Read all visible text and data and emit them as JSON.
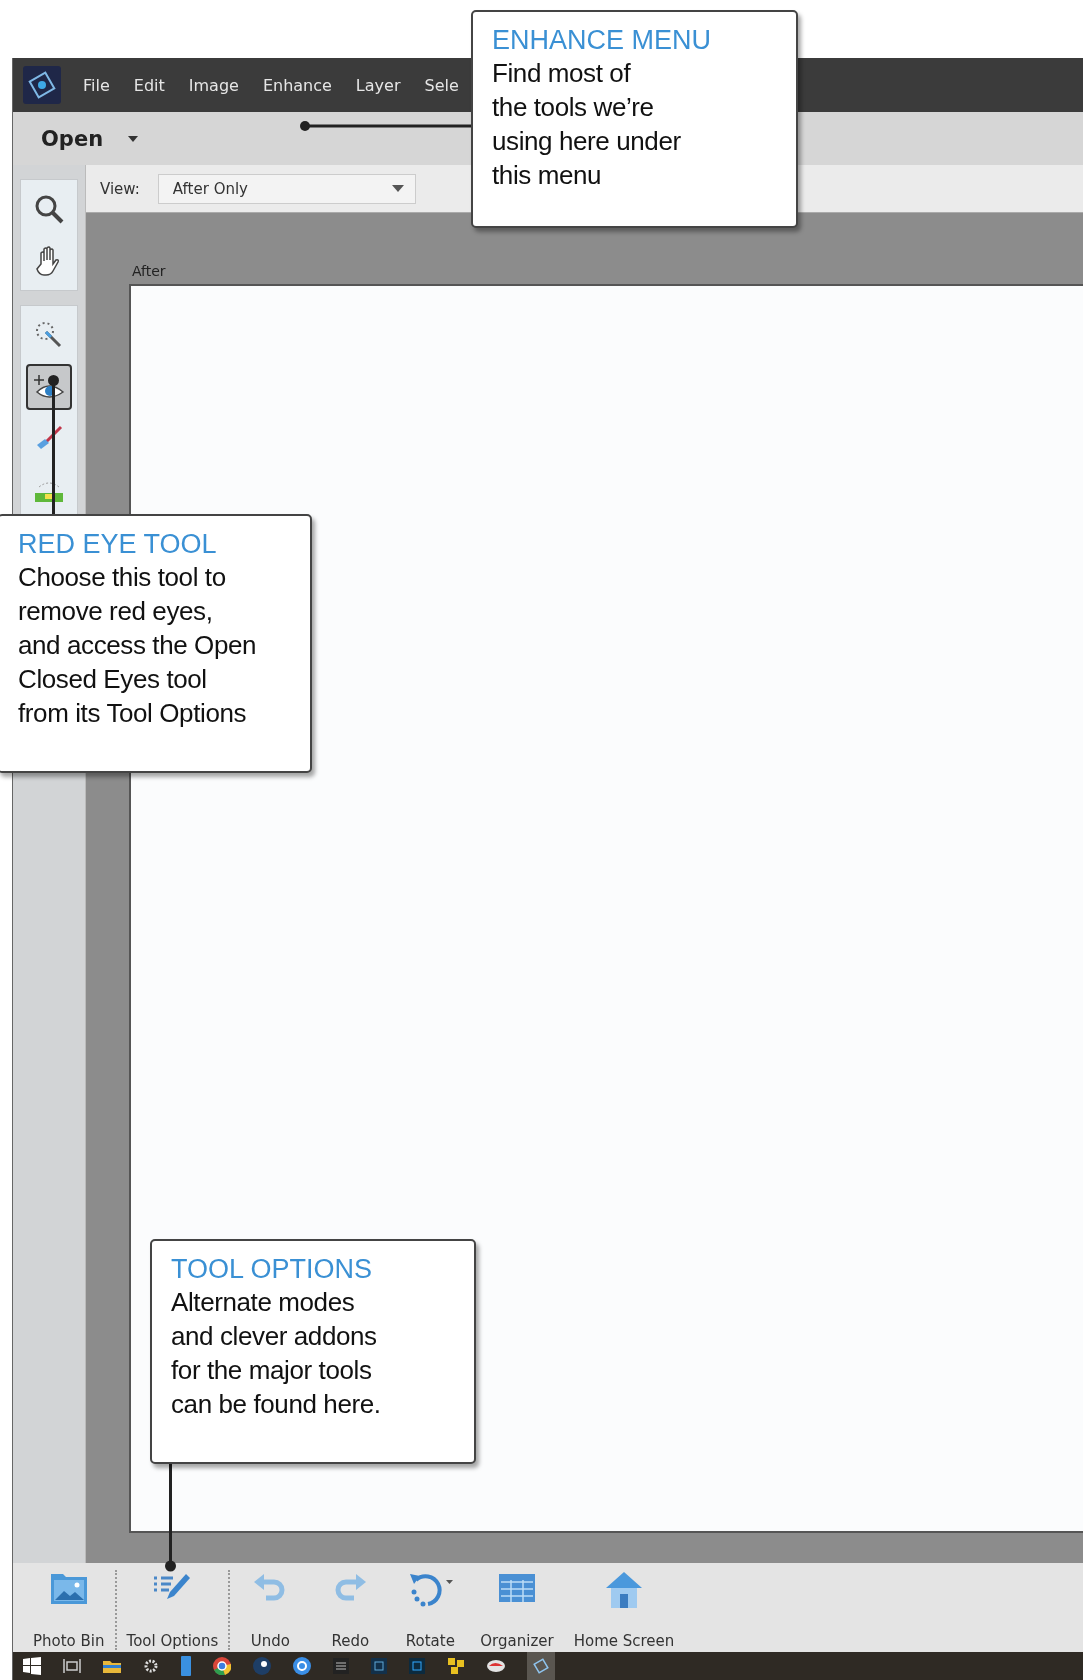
{
  "menu_bar": {
    "items": [
      "File",
      "Edit",
      "Image",
      "Enhance",
      "Layer",
      "Sele"
    ]
  },
  "open_button": {
    "label": "Open"
  },
  "view": {
    "label": "View:",
    "value": "After Only"
  },
  "tool_groups": [
    {
      "tools": [
        {
          "kind": "zoom",
          "selected": false
        },
        {
          "kind": "hand",
          "selected": false
        }
      ]
    },
    {
      "tools": [
        {
          "kind": "quick-select",
          "selected": false
        },
        {
          "kind": "eye",
          "selected": true
        },
        {
          "kind": "whiten",
          "selected": false
        },
        {
          "kind": "straighten",
          "selected": false
        }
      ]
    }
  ],
  "canvas": {
    "label": "After"
  },
  "bottom_bar": [
    {
      "kind": "photo-bin",
      "label": "Photo Bin"
    },
    {
      "kind": "tool-options",
      "label": "Tool Options"
    },
    {
      "kind": "undo",
      "label": "Undo"
    },
    {
      "kind": "redo",
      "label": "Redo"
    },
    {
      "kind": "rotate",
      "label": "Rotate"
    },
    {
      "kind": "organizer",
      "label": "Organizer"
    },
    {
      "kind": "home",
      "label": "Home Screen"
    }
  ],
  "callouts": [
    {
      "kind": "enhance",
      "title": "ENHANCE MENU",
      "lines": [
        "Find most of",
        "the tools we’re",
        "using here under",
        "this menu"
      ]
    },
    {
      "kind": "eye",
      "title": "RED EYE TOOL",
      "lines": [
        "Choose this tool to",
        "remove red eyes,",
        "and access the Open",
        "Closed Eyes tool",
        "from its Tool Options"
      ]
    },
    {
      "kind": "tool-options",
      "title": "TOOL OPTIONS",
      "lines": [
        "Alternate modes",
        "and clever addons",
        "for the major tools",
        "can be found here."
      ]
    }
  ]
}
